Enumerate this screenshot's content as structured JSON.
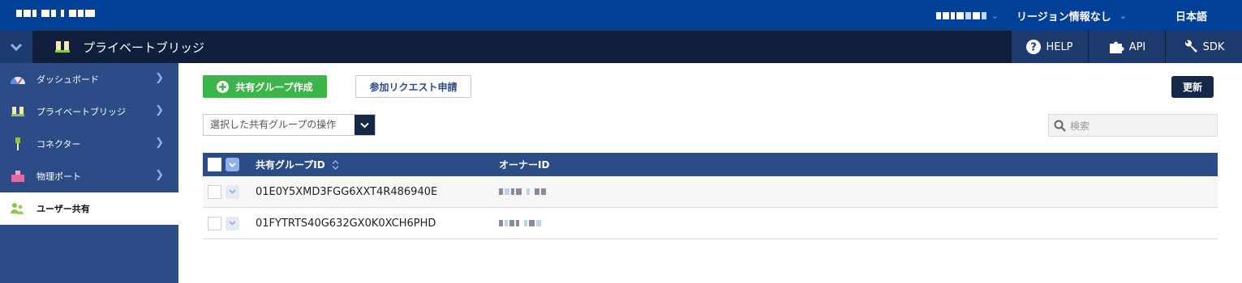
{
  "topbar": {
    "region_label": "リージョン情報なし",
    "language": "日本語"
  },
  "subbar": {
    "page_title": "プライベートブリッジ",
    "buttons": [
      {
        "label": "HELP",
        "icon": "help-circle-icon"
      },
      {
        "label": "API",
        "icon": "puzzle-icon"
      },
      {
        "label": "SDK",
        "icon": "wrench-icon"
      }
    ]
  },
  "sidebar": {
    "items": [
      {
        "label": "ダッシュボード",
        "icon": "gauge-icon"
      },
      {
        "label": "プライベートブリッジ",
        "icon": "bridge-icon"
      },
      {
        "label": "コネクター",
        "icon": "connector-icon"
      },
      {
        "label": "物理ポート",
        "icon": "port-icon"
      },
      {
        "label": "ユーザー共有",
        "icon": "users-icon"
      }
    ],
    "active_index": 4
  },
  "toolbar": {
    "create_label": "共有グループ作成",
    "join_label": "参加リクエスト申請",
    "refresh_label": "更新",
    "ops_label": "選択した共有グループの操作",
    "search_placeholder": "検索"
  },
  "table": {
    "headers": {
      "group_id": "共有グループID",
      "owner_id": "オーナーID"
    },
    "rows": [
      {
        "group_id": "01E0Y5XMD3FGG6XXT4R486940E"
      },
      {
        "group_id": "01FYTRTS40G632GX0K0XCH6PHD"
      }
    ]
  },
  "colors": {
    "top_bar": "#004098",
    "sub_bar": "#0f1f3c",
    "sidebar": "#2b4c86",
    "create_button": "#3bb54a",
    "dark_button": "#16284a"
  }
}
